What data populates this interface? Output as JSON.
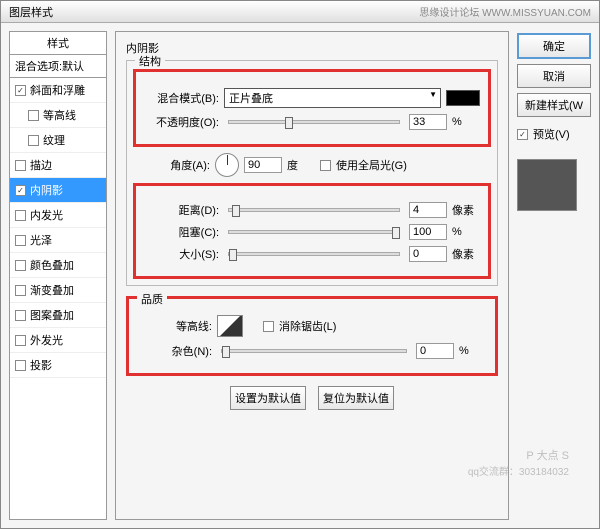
{
  "title": "图层样式",
  "title_right": "思缘设计论坛    WWW.MISSYUAN.COM",
  "left": {
    "header": "样式",
    "blend": "混合选项:默认",
    "items": [
      {
        "label": "斜面和浮雕",
        "checked": true,
        "indent": false
      },
      {
        "label": "等高线",
        "checked": false,
        "indent": true
      },
      {
        "label": "纹理",
        "checked": false,
        "indent": true
      },
      {
        "label": "描边",
        "checked": false,
        "indent": false
      },
      {
        "label": "内阴影",
        "checked": true,
        "indent": false,
        "sel": true
      },
      {
        "label": "内发光",
        "checked": false,
        "indent": false
      },
      {
        "label": "光泽",
        "checked": false,
        "indent": false
      },
      {
        "label": "颜色叠加",
        "checked": false,
        "indent": false
      },
      {
        "label": "渐变叠加",
        "checked": false,
        "indent": false
      },
      {
        "label": "图案叠加",
        "checked": false,
        "indent": false
      },
      {
        "label": "外发光",
        "checked": false,
        "indent": false
      },
      {
        "label": "投影",
        "checked": false,
        "indent": false
      }
    ]
  },
  "panel": {
    "title": "内阴影",
    "structure": {
      "legend": "结构",
      "blend_mode_label": "混合模式(B):",
      "blend_mode_value": "正片叠底",
      "opacity_label": "不透明度(O):",
      "opacity_value": "33",
      "opacity_unit": "%",
      "angle_label": "角度(A):",
      "angle_value": "90",
      "angle_unit": "度",
      "global_label": "使用全局光(G)",
      "global_checked": false,
      "distance_label": "距离(D):",
      "distance_value": "4",
      "distance_unit": "像素",
      "choke_label": "阻塞(C):",
      "choke_value": "100",
      "choke_unit": "%",
      "size_label": "大小(S):",
      "size_value": "0",
      "size_unit": "像素"
    },
    "quality": {
      "legend": "品质",
      "contour_label": "等高线:",
      "antialias_label": "消除锯齿(L)",
      "antialias_checked": false,
      "noise_label": "杂色(N):",
      "noise_value": "0",
      "noise_unit": "%"
    },
    "set_default": "设置为默认值",
    "reset_default": "复位为默认值"
  },
  "right": {
    "ok": "确定",
    "cancel": "取消",
    "new_style": "新建样式(W",
    "preview_label": "预览(V)",
    "preview_checked": true
  },
  "watermark": {
    "a": "P 大点 S",
    "b": "qq交流群：303184032"
  }
}
